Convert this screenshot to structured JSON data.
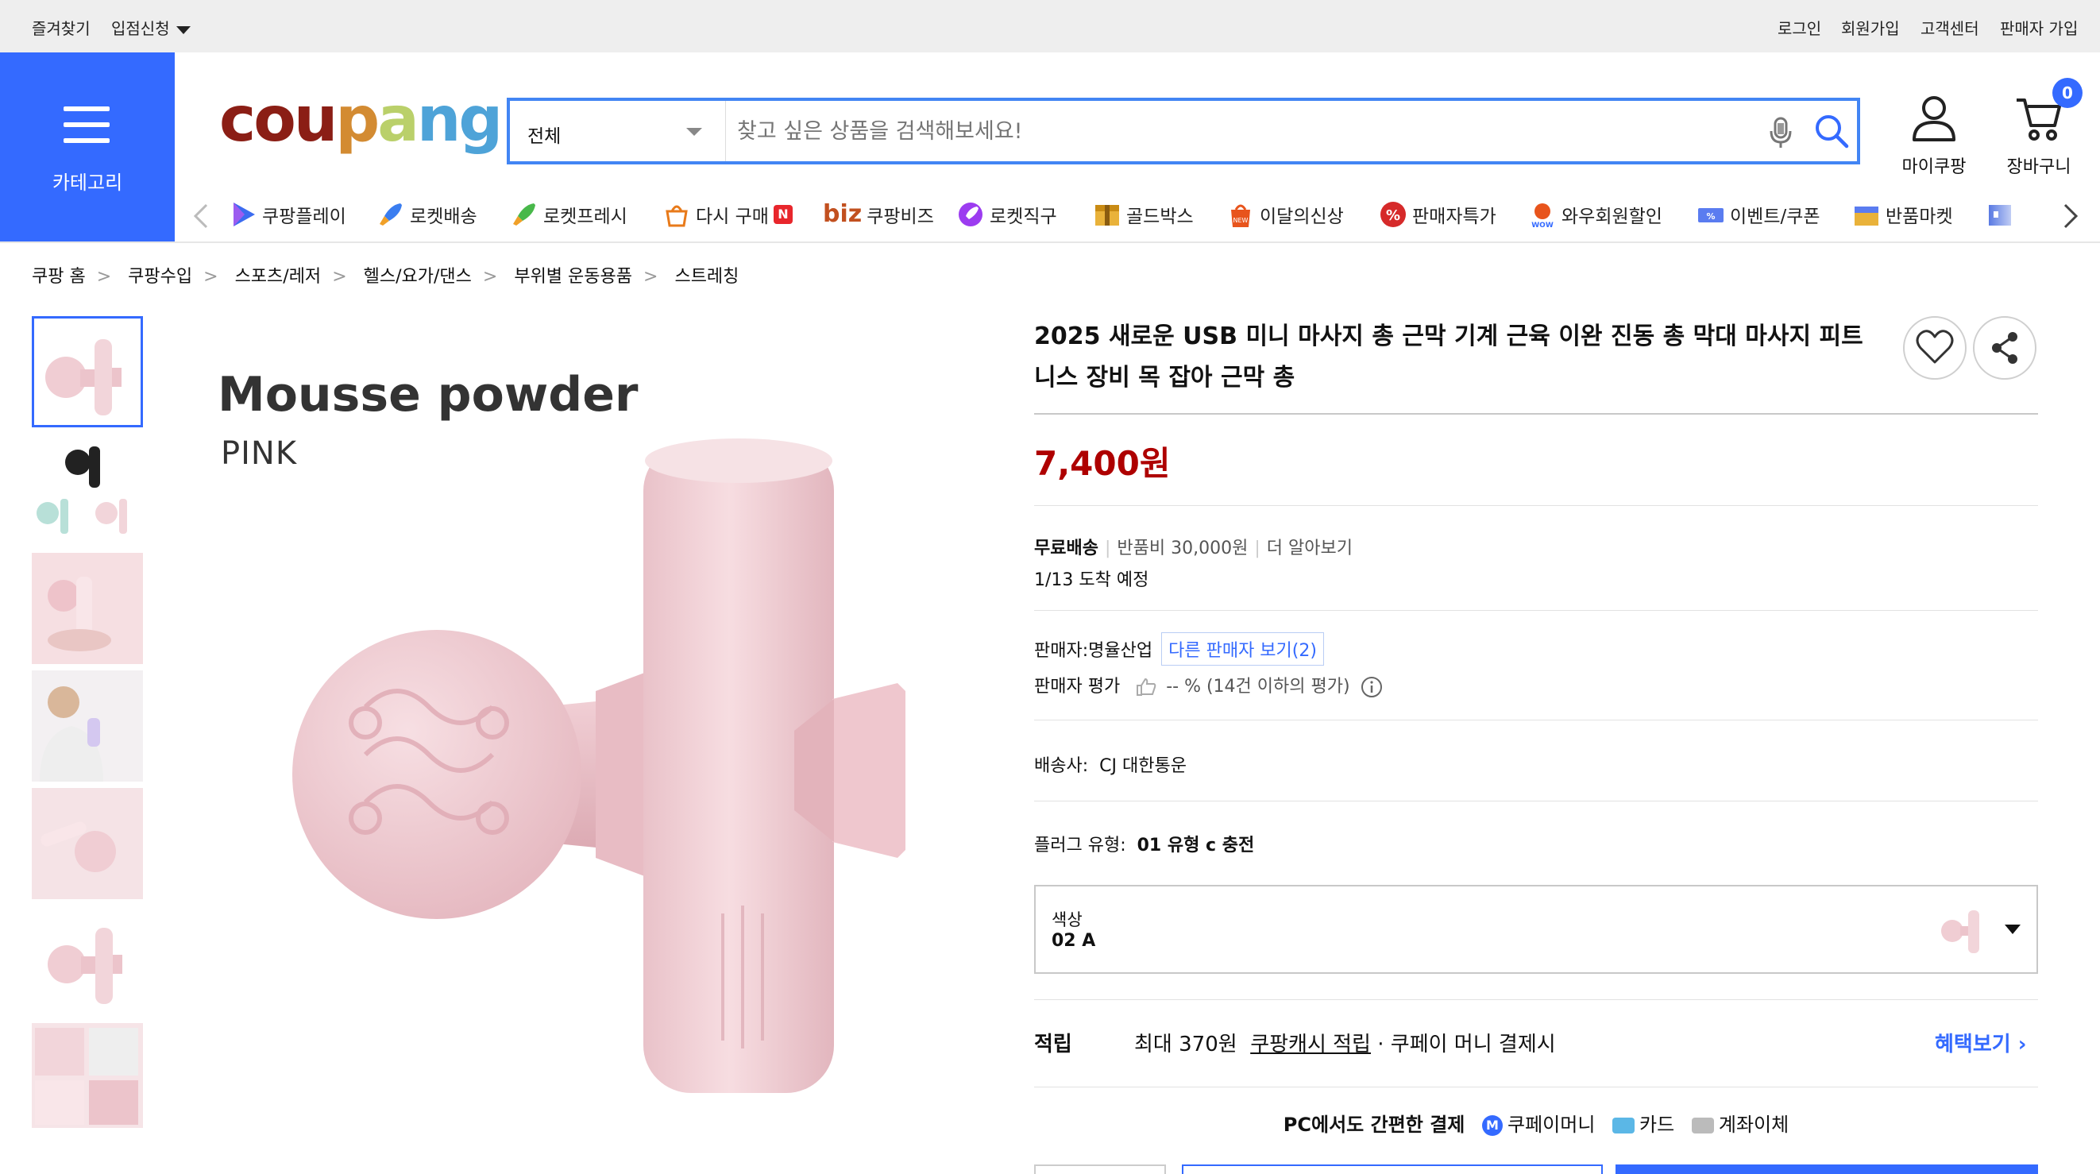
{
  "topbar": {
    "bookmark": "즐겨찾기",
    "partner_apply": "입점신청",
    "login": "로그인",
    "signup": "회원가입",
    "customer_center": "고객센터",
    "seller_signup": "판매자 가입"
  },
  "category_button": {
    "label": "카테고리"
  },
  "logo": {
    "text": "coupang"
  },
  "search": {
    "category": "전체",
    "placeholder": "찾고 싶은 상품을 검색해보세요!"
  },
  "header_actions": {
    "my_coupang": "마이쿠팡",
    "cart": "장바구니",
    "cart_count": "0"
  },
  "nav": {
    "items": [
      {
        "label": "쿠팡플레이",
        "icon": "play-icon"
      },
      {
        "label": "로켓배송",
        "icon": "rocket-icon"
      },
      {
        "label": "로켓프레시",
        "icon": "rocket-fresh-icon"
      },
      {
        "label": "다시 구매",
        "icon": "rebuy-icon",
        "badge": "N"
      },
      {
        "label": "쿠팡비즈",
        "icon": "biz-icon",
        "prefix": "biz"
      },
      {
        "label": "로켓직구",
        "icon": "global-icon"
      },
      {
        "label": "골드박스",
        "icon": "goldbox-icon"
      },
      {
        "label": "이달의신상",
        "icon": "new-icon"
      },
      {
        "label": "판매자특가",
        "icon": "percent-icon"
      },
      {
        "label": "와우회원할인",
        "icon": "wow-icon"
      },
      {
        "label": "이벤트/쿠폰",
        "icon": "coupon-icon"
      },
      {
        "label": "반품마켓",
        "icon": "return-market-icon"
      }
    ]
  },
  "breadcrumb": [
    "쿠팡 홈",
    "쿠팡수입",
    "스포츠/레저",
    "헬스/요가/댄스",
    "부위별 운동용품",
    "스트레칭"
  ],
  "main_image": {
    "title": "Mousse powder",
    "subtitle": "PINK"
  },
  "product": {
    "title": "2025 새로운 USB 미니 마사지 총 근막 기계 근육 이완 진동 총 막대 마사지 피트니스 장비 목 잡아 근막 총",
    "price": "7,400원",
    "shipping": "무료배송",
    "return_fee": "반품비 30,000원",
    "learn_more": "더 알아보기",
    "arrival": "1/13 도착 예정",
    "seller_label": "판매자:",
    "seller_name": "명율산업",
    "other_sellers": "다른 판매자 보기(2)",
    "seller_rating_label": "판매자 평가",
    "seller_rating_value": "-- % (14건 이하의 평가)",
    "carrier_label": "배송사:",
    "carrier_name": "CJ 대한통운",
    "plug_label": "플러그 유형:",
    "plug_value": "01 유형 c 충전",
    "option_label": "색상",
    "option_value": "02 A",
    "reward_label": "적립",
    "reward_prefix": "최대 370원",
    "reward_link": "쿠팡캐시 적립",
    "reward_suffix": "· 쿠페이 머니 결제시",
    "benefit_link": "혜택보기",
    "pay_title": "PC에서도 간편한 결제",
    "pay_methods": [
      "쿠페이머니",
      "카드",
      "계좌이체"
    ]
  },
  "colors": {
    "brand_blue": "#346aff",
    "price_red": "#ae0000",
    "search_border": "#4285f4",
    "product_pink": "#f2d5da"
  }
}
